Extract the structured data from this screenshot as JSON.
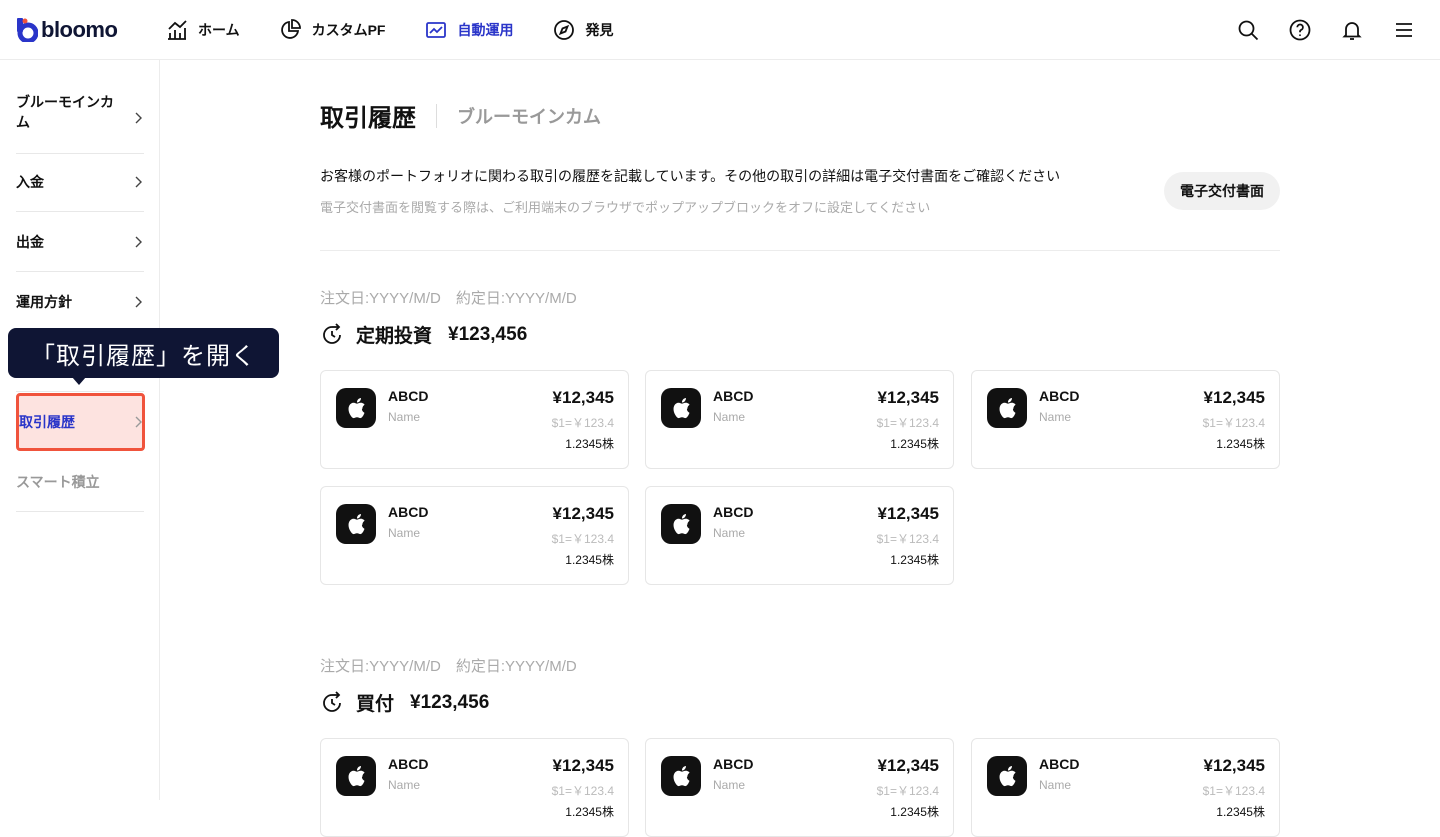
{
  "brand": {
    "name": "bloomo",
    "color": "#2a35c9"
  },
  "nav": [
    {
      "label": "ホーム",
      "icon": "chart-home-icon"
    },
    {
      "label": "カスタムPF",
      "icon": "pie-chart-icon"
    },
    {
      "label": "自動運用",
      "icon": "line-chart-icon",
      "active": true
    },
    {
      "label": "発見",
      "icon": "compass-icon"
    }
  ],
  "header_icons": [
    "search-icon",
    "help-icon",
    "bell-icon",
    "menu-icon"
  ],
  "sidebar": {
    "items": [
      {
        "label": "ブルーモインカム"
      },
      {
        "label": "入金"
      },
      {
        "label": "出金"
      },
      {
        "label": "運用方針"
      },
      {
        "label": "取引履歴",
        "active": true
      },
      {
        "label": "スマート積立",
        "disabled": true
      }
    ]
  },
  "tooltip": {
    "text": "「取引履歴」を開く"
  },
  "page": {
    "title": "取引履歴",
    "subtitle": "ブルーモインカム",
    "description": "お客様のポートフォリオに関わる取引の履歴を記載しています。その他の取引の詳細は電子交付書面をご確認ください",
    "note": "電子交付書面を閲覧する際は、ご利用端末のブラウザでポップアップブロックをオフに設定してください",
    "doc_button": "電子交付書面"
  },
  "sections": [
    {
      "dates": "注文日:YYYY/M/D　約定日:YYYY/M/D",
      "type": "定期投資",
      "amount": "¥123,456",
      "cards": [
        {
          "symbol": "ABCD",
          "name": "Name",
          "price": "¥12,345",
          "rate": "$1=￥123.4",
          "qty": "1.2345株"
        },
        {
          "symbol": "ABCD",
          "name": "Name",
          "price": "¥12,345",
          "rate": "$1=￥123.4",
          "qty": "1.2345株"
        },
        {
          "symbol": "ABCD",
          "name": "Name",
          "price": "¥12,345",
          "rate": "$1=￥123.4",
          "qty": "1.2345株"
        },
        {
          "symbol": "ABCD",
          "name": "Name",
          "price": "¥12,345",
          "rate": "$1=￥123.4",
          "qty": "1.2345株"
        },
        {
          "symbol": "ABCD",
          "name": "Name",
          "price": "¥12,345",
          "rate": "$1=￥123.4",
          "qty": "1.2345株"
        }
      ]
    },
    {
      "dates": "注文日:YYYY/M/D　約定日:YYYY/M/D",
      "type": "買付",
      "amount": "¥123,456",
      "cards": [
        {
          "symbol": "ABCD",
          "name": "Name",
          "price": "¥12,345",
          "rate": "$1=￥123.4",
          "qty": "1.2345株"
        },
        {
          "symbol": "ABCD",
          "name": "Name",
          "price": "¥12,345",
          "rate": "$1=￥123.4",
          "qty": "1.2345株"
        },
        {
          "symbol": "ABCD",
          "name": "Name",
          "price": "¥12,345",
          "rate": "$1=￥123.4",
          "qty": "1.2345株"
        }
      ]
    }
  ]
}
